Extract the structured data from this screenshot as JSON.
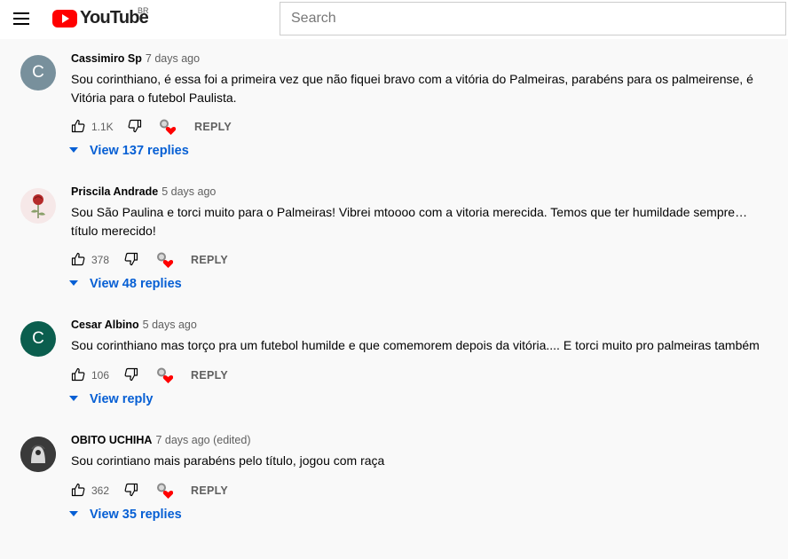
{
  "header": {
    "logo_text": "YouTube",
    "region": "BR",
    "search_placeholder": "Search"
  },
  "comments": [
    {
      "avatar_letter": "C",
      "avatar_color": "#78909c",
      "author": "Cassimiro Sp",
      "time": "7 days ago",
      "edited": "",
      "text": "Sou corinthiano, é essa foi a primeira vez que não fiquei bravo com a vitória do Palmeiras, parabéns para os palmeirense, é Vitória para o futebol Paulista.",
      "likes": "1.1K",
      "reply_label": "REPLY",
      "replies_label": "View 137 replies"
    },
    {
      "avatar_letter": "",
      "avatar_color": "#f3dede",
      "author": "Priscila Andrade",
      "time": "5 days ago",
      "edited": "",
      "text": "Sou São Paulina e torci muito para o Palmeiras! Vibrei mtoooo com a vitoria merecida. Temos que ter humildade sempre… título merecido!",
      "likes": "378",
      "reply_label": "REPLY",
      "replies_label": "View 48 replies"
    },
    {
      "avatar_letter": "C",
      "avatar_color": "#0b5e4e",
      "author": "Cesar Albino",
      "time": "5 days ago",
      "edited": "",
      "text": "Sou corinthiano mas torço pra um futebol humilde e que comemorem depois da vitória.... E torci muito pro palmeiras também",
      "likes": "106",
      "reply_label": "REPLY",
      "replies_label": "View reply"
    },
    {
      "avatar_letter": "",
      "avatar_color": "#2b2b2b",
      "author": "OBITO UCHIHA",
      "time": "7 days ago",
      "edited": "(edited)",
      "text": "Sou corintiano mais parabéns pelo título, jogou com raça",
      "likes": "362",
      "reply_label": "REPLY",
      "replies_label": "View 35 replies"
    }
  ]
}
